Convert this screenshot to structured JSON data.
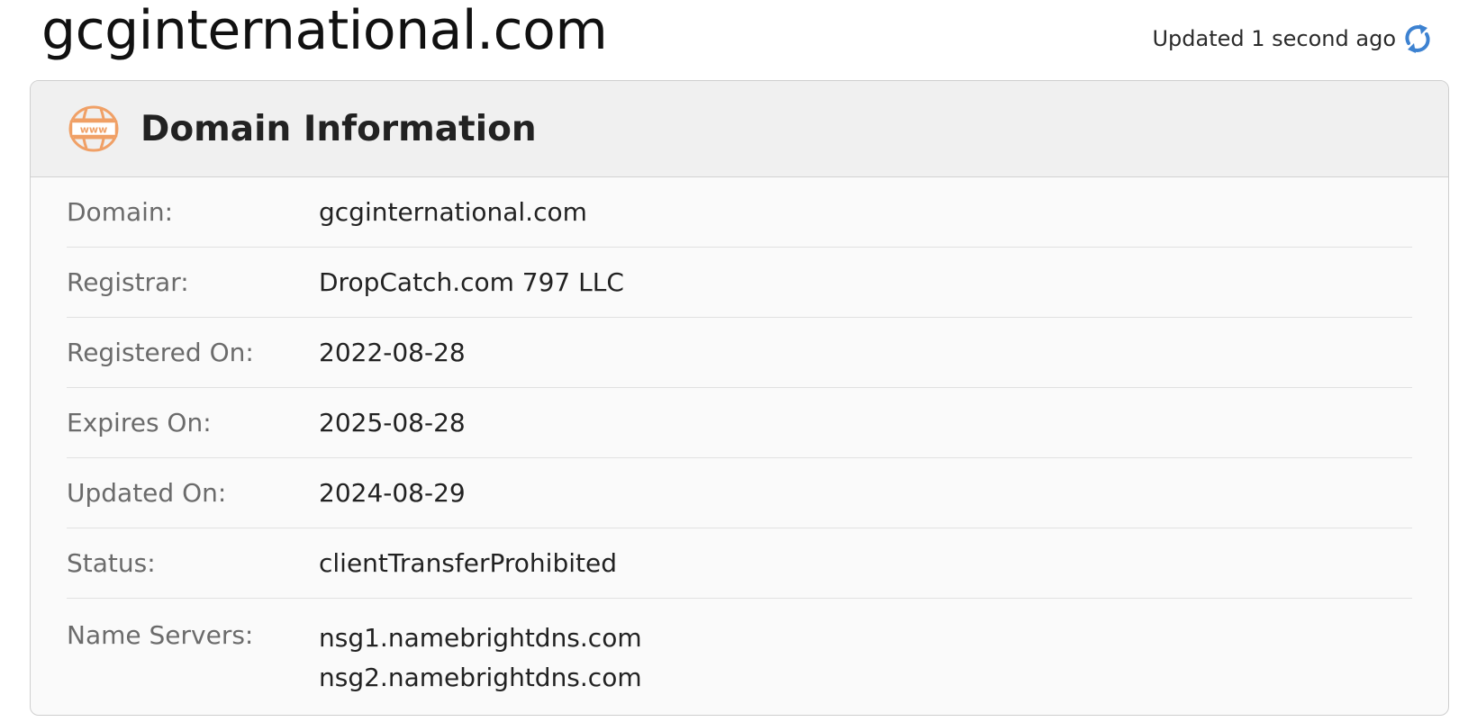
{
  "header": {
    "title": "gcginternational.com",
    "updated_text": "Updated 1 second ago",
    "refresh_icon": "refresh-icon"
  },
  "card": {
    "title": "Domain Information",
    "icon": "www-globe-icon",
    "rows": [
      {
        "label": "Domain:",
        "value": "gcginternational.com"
      },
      {
        "label": "Registrar:",
        "value": "DropCatch.com 797 LLC"
      },
      {
        "label": "Registered On:",
        "value": "2022-08-28"
      },
      {
        "label": "Expires On:",
        "value": "2025-08-28"
      },
      {
        "label": "Updated On:",
        "value": "2024-08-29"
      },
      {
        "label": "Status:",
        "value": "clientTransferProhibited"
      },
      {
        "label": "Name Servers:",
        "values": [
          "nsg1.namebrightdns.com",
          "nsg2.namebrightdns.com"
        ]
      }
    ]
  },
  "colors": {
    "accent_orange": "#f0a066",
    "refresh_blue": "#3d82d1",
    "header_bg": "#f0f0f0",
    "card_bg": "#fafafa"
  }
}
